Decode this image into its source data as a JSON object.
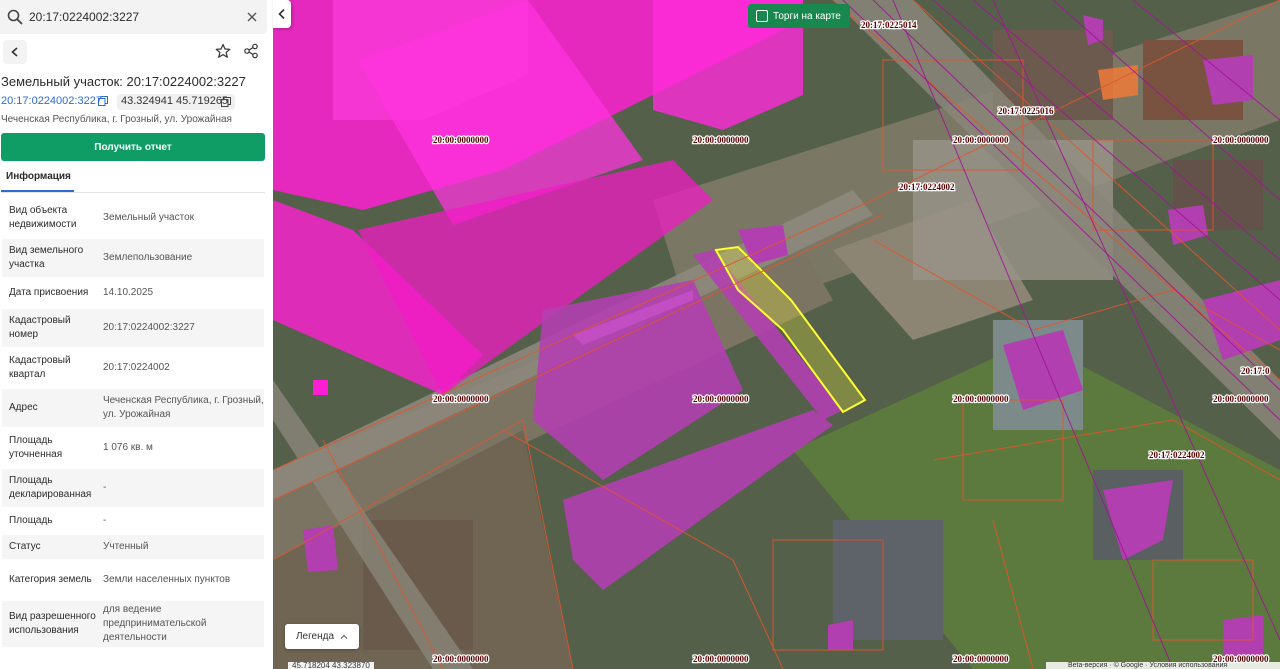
{
  "search": {
    "value": "20:17:0224002:3227"
  },
  "panel": {
    "title": "Земельный участок: 20:17:0224002:3227",
    "cadastral_link": "20:17:0224002:3227",
    "coordinates": "43.324941 45.719265",
    "address": "Чеченская Республика, г. Грозный, ул. Урожайная",
    "report_button": "Получить отчет",
    "tab_info": "Информация"
  },
  "properties": [
    {
      "label": "Вид объекта недвижимости",
      "value": "Земельный участок"
    },
    {
      "label": "Вид земельного участка",
      "value": "Землепользование"
    },
    {
      "label": "Дата присвоения",
      "value": "14.10.2025"
    },
    {
      "label": "Кадастровый номер",
      "value": "20:17:0224002:3227"
    },
    {
      "label": "Кадастровый квартал",
      "value": "20:17:0224002"
    },
    {
      "label": "Адрес",
      "value": "Чеченская Республика, г. Грозный, ул. Урожайная"
    },
    {
      "label": "Площадь уточненная",
      "value": "1 076 кв. м"
    },
    {
      "label": "Площадь декларированная",
      "value": "-"
    },
    {
      "label": "Площадь",
      "value": "-"
    },
    {
      "label": "Статус",
      "value": "Учтенный"
    },
    {
      "label": "Категория земель",
      "value": "Земли населенных пунктов"
    },
    {
      "label": "Вид разрешенного использования",
      "value": "для ведение предпринимательской деятельности"
    }
  ],
  "map": {
    "trade_button": "Торги на карте",
    "legend_button": "Легенда",
    "scale_text": "45.718204  43.323870",
    "attribution": "Beta-версия · © Google · Условия использования",
    "labels": {
      "q0225014": "20:17:0225014",
      "q0225016": "20:17:0225016",
      "q0224002": "20:17:0224002",
      "q0000000": "20:00:0000000",
      "q17_0": "20:17:0"
    }
  },
  "colors": {
    "accent_green": "#0f9d65",
    "link_blue": "#2d6bd6",
    "parcel_magenta": "#ff1fd2",
    "selected_parcel": "#ffff33"
  },
  "icons": {
    "search": "search-icon",
    "clear": "close-icon",
    "back": "chevron-left-icon",
    "favorite": "star-icon",
    "share": "share-icon",
    "copy": "copy-icon",
    "collapse": "chevron-left-icon",
    "legend": "chevron-up-icon"
  }
}
